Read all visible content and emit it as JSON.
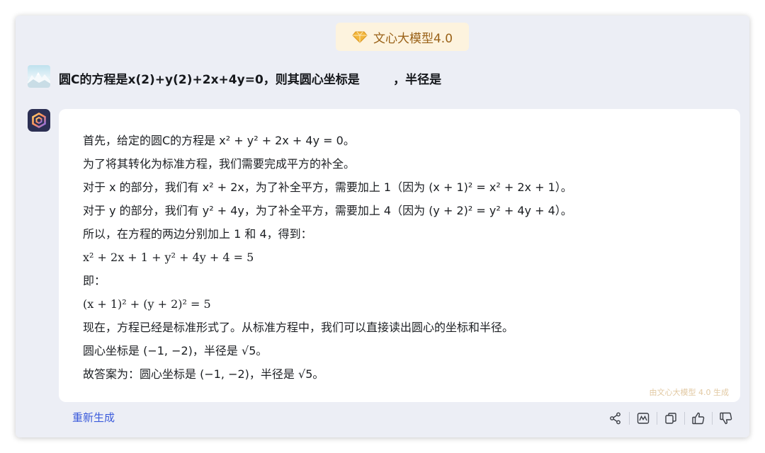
{
  "header": {
    "model_name": "文心大模型4.0",
    "icon": "diamond-icon"
  },
  "user": {
    "avatar": "snow-landscape-avatar",
    "question": "圆C的方程是x(2)+y(2)+2x+4y=0，则其圆心坐标是        ，半径是"
  },
  "assistant": {
    "avatar": "ernie-logo-icon",
    "answer_lines": [
      "首先，给定的圆C的方程是 x² + y² + 2x + 4y = 0。",
      "为了将其转化为标准方程，我们需要完成平方的补全。",
      "对于 x 的部分，我们有 x² + 2x，为了补全平方，需要加上 1（因为 (x + 1)² = x² + 2x + 1）。",
      "对于 y 的部分，我们有 y² + 4y，为了补全平方，需要加上 4（因为 (y + 2)² = y² + 4y + 4）。",
      "所以，在方程的两边分别加上 1 和 4，得到：",
      "x² + 2x + 1 + y² + 4y + 4 = 5",
      "即：",
      "(x + 1)² + (y + 2)² = 5",
      "现在，方程已经是标准形式了。从标准方程中，我们可以直接读出圆心的坐标和半径。",
      "圆心坐标是 (−1, −2)，半径是 √5。",
      "故答案为：圆心坐标是 (−1, −2)，半径是 √5。"
    ],
    "watermark": "由文心大模型 4.0 生成"
  },
  "footer": {
    "regenerate_label": "重新生成",
    "actions": [
      "share-icon",
      "chart-icon",
      "copy-icon",
      "thumbs-up-icon",
      "thumbs-down-icon"
    ]
  },
  "colors": {
    "accent": "#3b5bdb",
    "badge_bg": "#fdf3de",
    "badge_text": "#9a6218",
    "window_bg": "#eceef5"
  }
}
